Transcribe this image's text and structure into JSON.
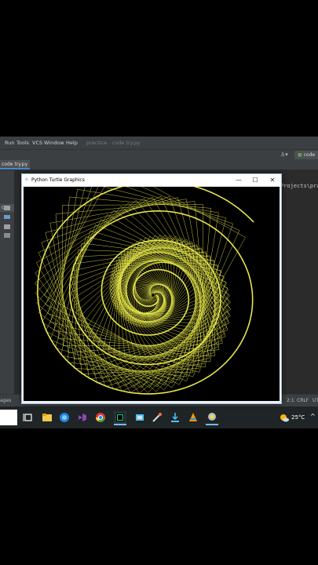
{
  "ide": {
    "menu": [
      "Run",
      "Tools",
      "VCS",
      "Window",
      "Help"
    ],
    "project_title": "practice - code try.py",
    "editor_tab": "code try.py",
    "side_tab": "co",
    "path_fragment": "Projects\\pra",
    "right_button": "code",
    "status_left": "ages",
    "status_right": [
      "2:1",
      "CRLF",
      "UT"
    ]
  },
  "turtle_window": {
    "title": "Python Turtle Graphics",
    "minimize": "—",
    "maximize": "☐",
    "close": "✕",
    "spiral_color": "#e6e64a"
  },
  "taskbar": {
    "weather": "25°C",
    "chevron": "^"
  }
}
